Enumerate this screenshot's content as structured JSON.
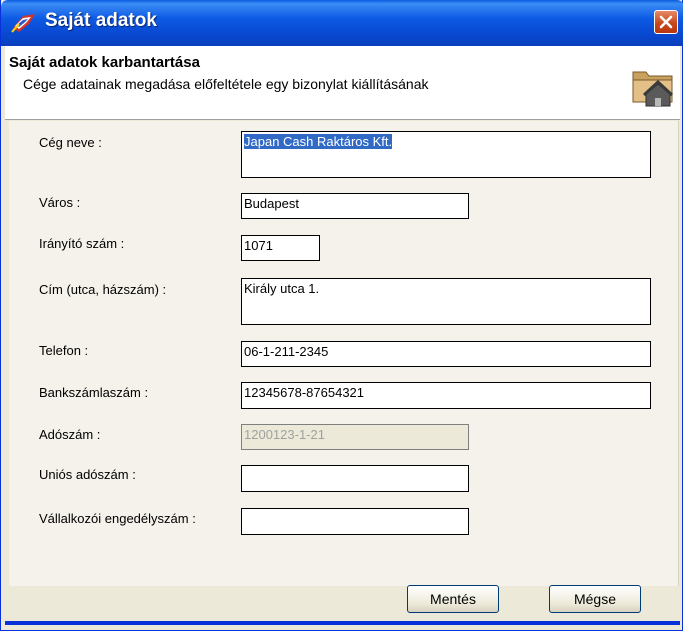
{
  "window": {
    "title": "Saját adatok"
  },
  "header": {
    "title": "Saját adatok karbantartása",
    "subtitle": "Cége adatainak megadása előfeltétele egy bizonylat kiállításának"
  },
  "form": {
    "company_name": {
      "label": "Cég neve :",
      "value": "Japan Cash Raktáros Kft."
    },
    "city": {
      "label": "Város :",
      "value": "Budapest"
    },
    "zip": {
      "label": "Irányító szám :",
      "value": "1071"
    },
    "address": {
      "label": "Cím (utca, házszám) :",
      "value": "Király utca 1."
    },
    "phone": {
      "label": "Telefon :",
      "value": "06-1-211-2345"
    },
    "bank_account": {
      "label": "Bankszámlaszám :",
      "value": "12345678-87654321"
    },
    "tax_number": {
      "label": "Adószám :",
      "value": "1200123-1-21"
    },
    "eu_tax_number": {
      "label": "Uniós adószám :",
      "value": ""
    },
    "business_license": {
      "label": "Vállalkozói engedélyszám :",
      "value": ""
    }
  },
  "buttons": {
    "save": "Mentés",
    "cancel": "Mégse"
  },
  "icons": {
    "app": "app-flag-icon",
    "header": "folder-house-icon",
    "close": "close-icon"
  },
  "colors": {
    "titlebar": "#0a5be0",
    "close": "#c9491b",
    "selection": "#316ac5"
  }
}
